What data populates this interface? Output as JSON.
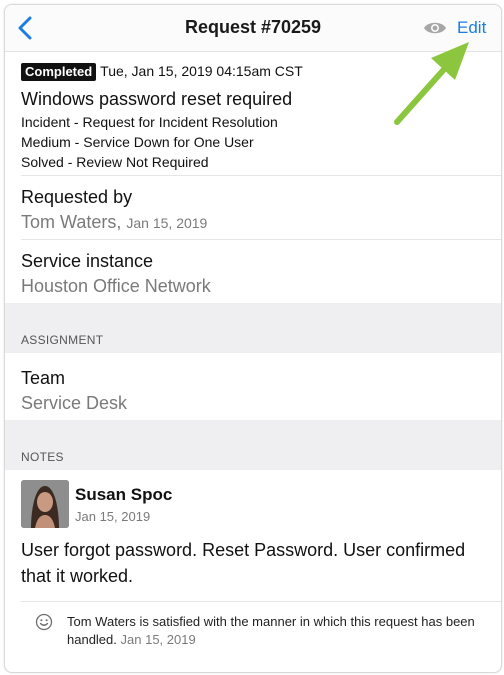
{
  "header": {
    "title": "Request #70259",
    "edit_label": "Edit"
  },
  "request": {
    "status_badge": "Completed",
    "datetime": "Tue, Jan 15, 2019 04:15am CST",
    "title": "Windows password reset required",
    "category": "Incident - Request for Incident Resolution",
    "priority": "Medium - Service Down for One User",
    "resolution": "Solved - Review Not Required"
  },
  "requested_by": {
    "label": "Requested by",
    "name": "Tom Waters,",
    "date": "Jan 15, 2019"
  },
  "service_instance": {
    "label": "Service instance",
    "value": "Houston Office Network"
  },
  "assignment": {
    "header": "ASSIGNMENT",
    "team_label": "Team",
    "team_value": "Service Desk"
  },
  "notes": {
    "header": "NOTES",
    "author": "Susan Spoc",
    "date": "Jan 15, 2019",
    "body": "User forgot password. Reset Password. User confirmed that it worked."
  },
  "satisfaction": {
    "text": "Tom Waters is satisfied with the manner in which this request has been handled.",
    "date": "Jan 15, 2019"
  },
  "colors": {
    "accent": "#1a7fe0",
    "arrow": "#8cc63f",
    "badge_bg": "#111111",
    "group_bg": "#efeff1"
  },
  "icons": [
    "chevron-left-icon",
    "eye-icon",
    "smiley-icon",
    "arrow-annotation"
  ]
}
